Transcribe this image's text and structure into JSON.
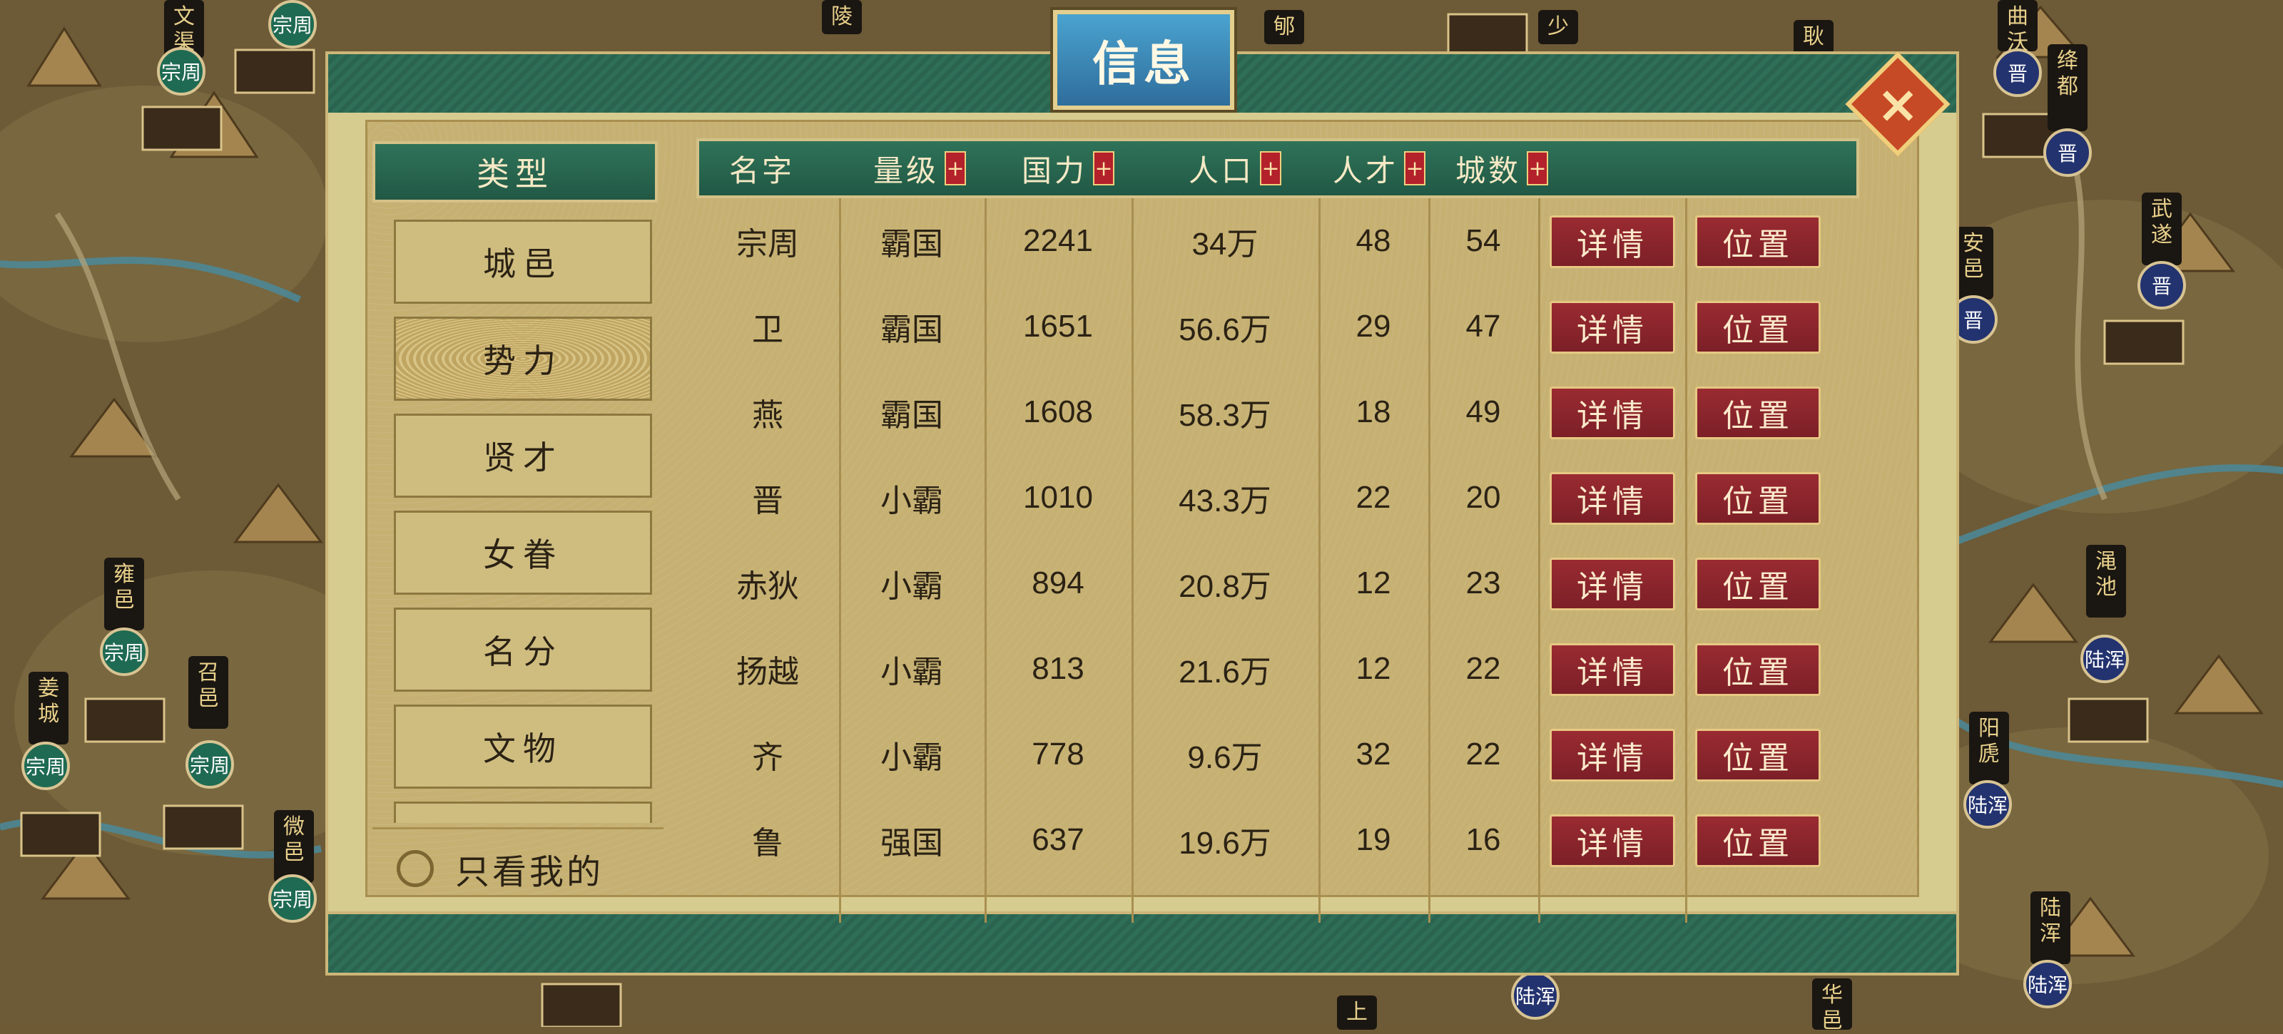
{
  "dialog": {
    "title": "信息",
    "close_icon": "close-icon"
  },
  "categories": {
    "header": "类型",
    "items": [
      "城邑",
      "势力",
      "贤才",
      "女眷",
      "名分",
      "文物"
    ],
    "active_index": 1,
    "only_mine_label": "只看我的"
  },
  "table": {
    "headers": [
      "名字",
      "量级",
      "国力",
      "人口",
      "人才",
      "城数"
    ],
    "sortable": [
      false,
      true,
      true,
      true,
      true,
      true
    ],
    "sort_icon": "+",
    "detail_label": "详情",
    "location_label": "位置",
    "rows": [
      {
        "name": "宗周",
        "rank": "霸国",
        "power": "2241",
        "population": "34万",
        "talent": "48",
        "cities": "54"
      },
      {
        "name": "卫",
        "rank": "霸国",
        "power": "1651",
        "population": "56.6万",
        "talent": "29",
        "cities": "47"
      },
      {
        "name": "燕",
        "rank": "霸国",
        "power": "1608",
        "population": "58.3万",
        "talent": "18",
        "cities": "49"
      },
      {
        "name": "晋",
        "rank": "小霸",
        "power": "1010",
        "population": "43.3万",
        "talent": "22",
        "cities": "20"
      },
      {
        "name": "赤狄",
        "rank": "小霸",
        "power": "894",
        "population": "20.8万",
        "talent": "12",
        "cities": "23"
      },
      {
        "name": "扬越",
        "rank": "小霸",
        "power": "813",
        "population": "21.6万",
        "talent": "12",
        "cities": "22"
      },
      {
        "name": "齐",
        "rank": "小霸",
        "power": "778",
        "population": "9.6万",
        "talent": "32",
        "cities": "22"
      },
      {
        "name": "鲁",
        "rank": "强国",
        "power": "637",
        "population": "19.6万",
        "talent": "19",
        "cities": "16"
      }
    ]
  },
  "map": {
    "city_tags": [
      "文渠",
      "陵",
      "郇",
      "少",
      "耿",
      "曲沃",
      "绛都",
      "安邑",
      "武遂",
      "雍邑",
      "姜城",
      "召邑",
      "微邑",
      "渑池",
      "阳虒",
      "陆浑",
      "上",
      "华邑"
    ],
    "faction_badges": [
      "宗周",
      "晋",
      "陆浑"
    ],
    "colors": {
      "zongzhou": "#1f6a52",
      "jin": "#23336f",
      "luhun": "#23336f"
    }
  }
}
